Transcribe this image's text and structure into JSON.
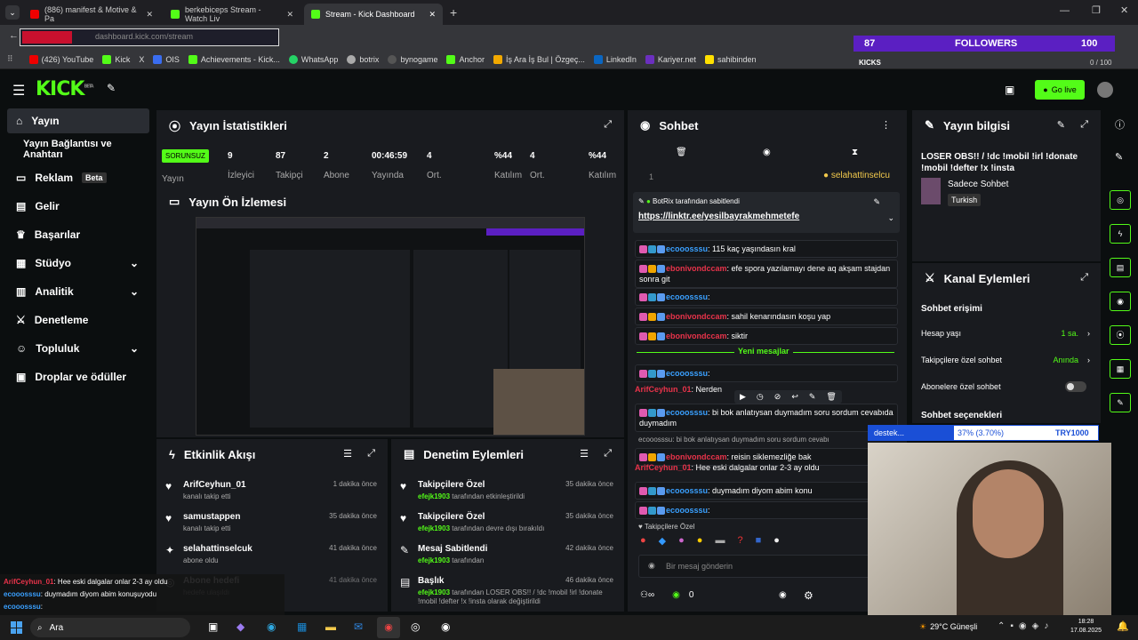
{
  "browser": {
    "tabs": [
      {
        "label": "(886) manifest & Motive & Pa"
      },
      {
        "label": "berkebiceps Stream - Watch Liv"
      },
      {
        "label": "Stream - Kick Dashboard"
      }
    ],
    "url": "dashboard.kick.com/stream",
    "bookmarks": [
      "(426) YouTube",
      "Kick",
      "X",
      "OIS",
      "Achievements - Kick...",
      "WhatsApp",
      "botrix",
      "bynogame",
      "Anchor",
      "İş Ara İş Bul | Özgeç...",
      "LinkedIn",
      "Kariyer.net",
      "sahibinden"
    ]
  },
  "overlay": {
    "followers_count": "87",
    "followers_label": "FOLLOWERS",
    "followers_goal": "100",
    "kicks_label": "KICKS",
    "kicks_value": "0 / 100",
    "kicks_progress": 0
  },
  "header": {
    "logo": "KICK",
    "beta": "BETA",
    "go_live": "Go live"
  },
  "sidebar": {
    "items": [
      {
        "label": "Yayın"
      },
      {
        "label": "Yayın Bağlantısı ve Anahtarı"
      },
      {
        "label": "Reklam",
        "badge": "Beta"
      },
      {
        "label": "Gelir"
      },
      {
        "label": "Başarılar"
      },
      {
        "label": "Stüdyo"
      },
      {
        "label": "Analitik"
      },
      {
        "label": "Denetleme"
      },
      {
        "label": "Topluluk"
      },
      {
        "label": "Droplar ve ödüller"
      }
    ]
  },
  "stats": {
    "title": "Yayın İstatistikleri",
    "status": "SORUNSUZ",
    "status_label": "Yayın",
    "cells": [
      {
        "value": "9",
        "label": "İzleyici"
      },
      {
        "value": "87",
        "label": "Takipçi"
      },
      {
        "value": "2",
        "label": "Abone"
      },
      {
        "value": "00:46:59",
        "label": "Yayında"
      },
      {
        "value": "4",
        "label": "Ort."
      },
      {
        "value": "%44",
        "label": "Katılım"
      },
      {
        "value": "4",
        "label": "Ort."
      },
      {
        "value": "%44",
        "label": "Katılım"
      }
    ]
  },
  "preview": {
    "title": "Yayın Ön İzlemesi"
  },
  "activity": {
    "title": "Etkinlik Akışı",
    "items": [
      {
        "name": "ArifCeyhun_01",
        "desc": "kanalı takip etti",
        "time": "1 dakika önce"
      },
      {
        "name": "samustappen",
        "desc": "kanalı takip etti",
        "time": "35 dakika önce"
      },
      {
        "name": "selahattinselcuk",
        "desc": "abone oldu",
        "time": "41 dakika önce"
      },
      {
        "name": "Abone hedefi",
        "desc": "hedefe ulaşıldı",
        "time": "41 dakika önce"
      }
    ]
  },
  "moderation": {
    "title": "Denetim Eylemleri",
    "items": [
      {
        "name": "Takipçilere Özel",
        "user": "efejk1903",
        "desc": "tarafından etkinleştirildi",
        "time": "35 dakika önce"
      },
      {
        "name": "Takipçilere Özel",
        "user": "efejk1903",
        "desc": "tarafından devre dışı bırakıldı",
        "time": "35 dakika önce"
      },
      {
        "name": "Mesaj Sabitlendi",
        "user": "efejk1903",
        "desc": "tarafından",
        "time": "42 dakika önce"
      },
      {
        "name": "Başlık",
        "user": "efejk1903",
        "desc": "tarafından LOSER OBS!! / !dc !mobil !irl !donate !mobil !defter !x !insta olarak değiştirildi",
        "time": "46 dakika önce"
      }
    ]
  },
  "chat": {
    "title": "Sohbet",
    "top_user": "selahattinselcu",
    "top_count": "1",
    "pinned_by": "BotRix tarafından sabitlendi",
    "pinned_link": "https://linktr.ee/yesilbayrakmehmetefe",
    "messages": [
      {
        "user": "ecooosssu",
        "text": ": 115 kaç yaşındasın kral"
      },
      {
        "user": "ebonivondccam",
        "text": ": efe spora yazılamayı dene aq akşam stajdan sonra git"
      },
      {
        "user": "ecooosssu",
        "text": ":"
      },
      {
        "user": "ebonivondccam",
        "text": ": sahil kenarındasın koşu yap"
      },
      {
        "user": "ebonivondccam",
        "text": ": siktir"
      }
    ],
    "new_messages": "Yeni mesajlar",
    "messages2": [
      {
        "user": "ecooosssu",
        "text": ":"
      },
      {
        "user": "ArifCeyhun_01",
        "text": ": Nerden"
      },
      {
        "user": "ecooosssu",
        "text": ": bi bok anlatıysan duymadım soru sordum cevabıda duymadım"
      },
      {
        "user": "ebonivondccam",
        "text": ": reisin siklemezliğe bak"
      },
      {
        "user": "ArifCeyhun_01",
        "text": ": Hee eski dalgalar onlar 2-3 ay oldu"
      },
      {
        "user": "ecooosssu",
        "text": ": duymadım diyom abim konu"
      },
      {
        "user": "ecooosssu",
        "text": ":"
      }
    ],
    "reply_preview": "ecooosssu: bi bok anlatıysan duymadım soru sordum cevabı",
    "followers_only": "Takipçilere Özel",
    "placeholder": "Bir mesaj gönderin",
    "kick_count": "0"
  },
  "info": {
    "title": "Yayın bilgisi",
    "stream_title": "LOSER OBS!! / !dc !mobil !irl !donate !mobil !defter !x !insta",
    "category": "Sadece Sohbet",
    "tag": "Turkish"
  },
  "channel_actions": {
    "title": "Kanal Eylemleri",
    "chat_access": "Sohbet erişimi",
    "rows": [
      {
        "label": "Hesap yaşı",
        "value": "1 sa."
      },
      {
        "label": "Takipçilere özel sohbet",
        "value": "Anında"
      },
      {
        "label": "Abonelere özel sohbet",
        "value": ""
      }
    ],
    "chat_options": "Sohbet seçenekleri"
  },
  "donation": {
    "label": "destek...",
    "percent": "37% (3.70%)",
    "goal": "TRY1000"
  },
  "overlay_chat": [
    {
      "user": "ArifCeyhun_01",
      "text": ": Hee eski dalgalar onlar 2-3 ay oldu"
    },
    {
      "user": "ecooosssu",
      "text": ": duymadım diyom abim konuşuyodu"
    },
    {
      "user": "ecooosssu",
      "text": ":"
    }
  ],
  "taskbar": {
    "search": "Ara",
    "weather": "29°C Güneşli",
    "time": "18:28",
    "date": "17.08.2025"
  },
  "colors": {
    "accent": "#53fc18",
    "panel": "#191b1f",
    "bg": "#0b0e0f",
    "purple": "#5b1fc2"
  }
}
